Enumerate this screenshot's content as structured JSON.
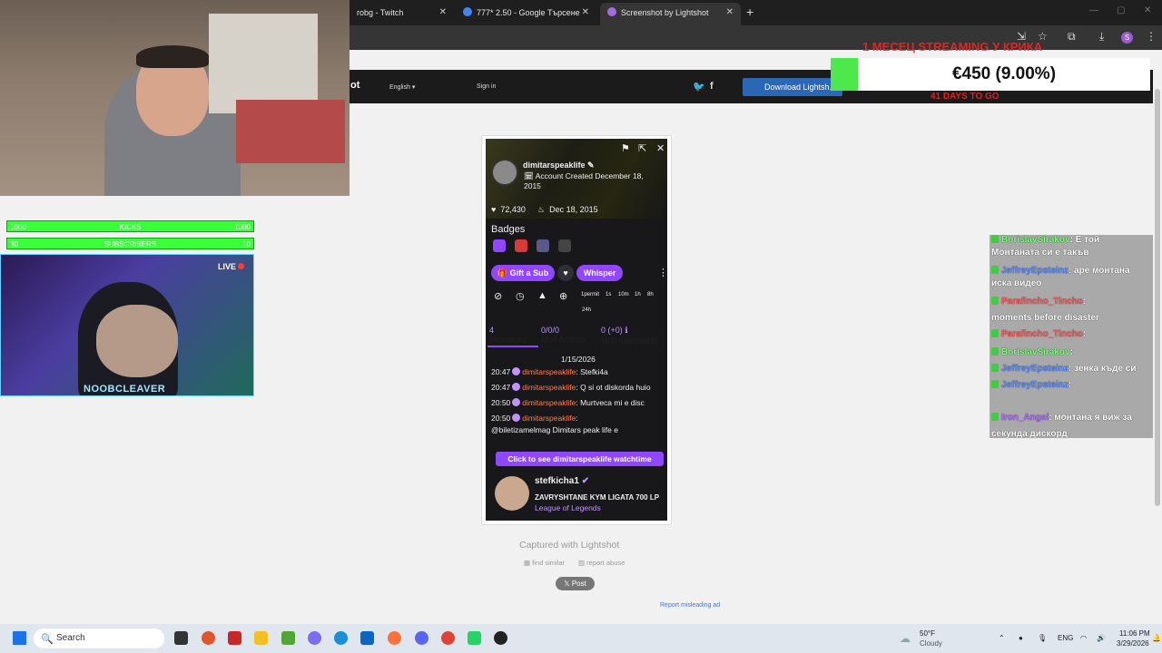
{
  "browser": {
    "tabs": [
      {
        "title": "robg - Twitch",
        "favicon_color": "#9147ff"
      },
      {
        "title": "777* 2.50 - Google Търсене",
        "favicon_color": "#4285f4"
      },
      {
        "title": "Screenshot by Lightshot",
        "favicon_color": "#a46be0"
      }
    ],
    "new_tab_label": "+",
    "profile_initial": "S"
  },
  "site": {
    "logo_fragment": "ot",
    "language": "English",
    "sign_in": "Sign in",
    "download_label": "Download Lightsh..."
  },
  "overlays": {
    "kicks": {
      "left": "1000",
      "label": "KICKS",
      "right": "1000"
    },
    "subs": {
      "left": "30",
      "label": "SUBSCRIBERS",
      "right": "10"
    },
    "live_label": "LIVE",
    "cam_name": "NOOBCLEAVER",
    "donation": {
      "amount": "€450 (9.00%)",
      "top_text": "1 МЕСЕЦ STREAMING У КРИКА",
      "bottom_text": "41 DAYS TO GO"
    }
  },
  "chat_overlay": [
    {
      "user": "BorislavSirakov",
      "user_color": "#7cff7c",
      "text": ": Е той"
    },
    {
      "user": "",
      "user_color": "#ffffff",
      "text": "Монтаната си е такъв"
    },
    {
      "user": "JeffreyEpsteinz",
      "user_color": "#5d8dff",
      "text": ": аре монтана"
    },
    {
      "user": "",
      "user_color": "#ffffff",
      "text": "иска видео"
    },
    {
      "user": "Parafincho_Tincho",
      "user_color": "#ff5a5a",
      "text": ":"
    },
    {
      "user": "",
      "user_color": "#ffffff",
      "text": "moments before disaster"
    },
    {
      "user": "Parafincho_Tincho",
      "user_color": "#ff5a5a",
      "text": ":"
    },
    {
      "user": "BorislavSirakov",
      "user_color": "#7cff7c",
      "text": ":"
    },
    {
      "user": "JeffreyEpsteinz",
      "user_color": "#5d8dff",
      "text": ": зенка къде си"
    },
    {
      "user": "JeffreyEpsteinz",
      "user_color": "#5d8dff",
      "text": ":"
    },
    {
      "user": "Iron_Angel",
      "user_color": "#b06cff",
      "text": ": монтана я виж за"
    },
    {
      "user": "",
      "user_color": "#ffffff",
      "text": "секунда дискорд"
    }
  ],
  "card": {
    "username": "dimitarspeaklife",
    "account_created": "Account Created December 18, 2015",
    "followers": "72,430",
    "followed_date": "Dec 18, 2015",
    "badges_title": "Badges",
    "gift_sub": "Gift a Sub",
    "whisper": "Whisper",
    "timeouts": [
      "1permit",
      "1s",
      "10m",
      "1h",
      "8h",
      "24h"
    ],
    "stats": [
      {
        "value": "4",
        "label": "Messages"
      },
      {
        "value": "0/0/0",
        "label": "Mod Actions"
      },
      {
        "value": "0 (+0)",
        "label": "Mod Comments"
      }
    ],
    "date": "1/15/2026",
    "messages": [
      {
        "time": "20:47",
        "user": "dimitarspeaklife",
        "text": ": Stefki4a"
      },
      {
        "time": "20:47",
        "user": "dimitarspeaklife",
        "text": ": Q si ot diskorda huio"
      },
      {
        "time": "20:50",
        "user": "dimitarspeaklife",
        "text": ": Murtveca mi e disc"
      },
      {
        "time": "20:50",
        "user": "dimitarspeaklife",
        "text": ":"
      }
    ],
    "last_line": "@biletizamelmag Dimitars peak life e",
    "watchtime_button": "Click to see dimitarspeaklife watchtime",
    "stream": {
      "channel": "stefkicha1",
      "title": "ZAVRYSHTANE KYM LIGATA 700 LP",
      "game": "League of Legends"
    }
  },
  "below_card": {
    "captured": "Captured with Lightshot",
    "find_similar": "find similar",
    "report_abuse": "report abuse",
    "post": "Post",
    "report_ad": "Report misleading ad"
  },
  "taskbar": {
    "search_placeholder": "Search",
    "weather_temp": "50°F",
    "weather_desc": "Cloudy",
    "lang": "ENG",
    "time": "11:06 PM",
    "date": "3/29/2026"
  }
}
